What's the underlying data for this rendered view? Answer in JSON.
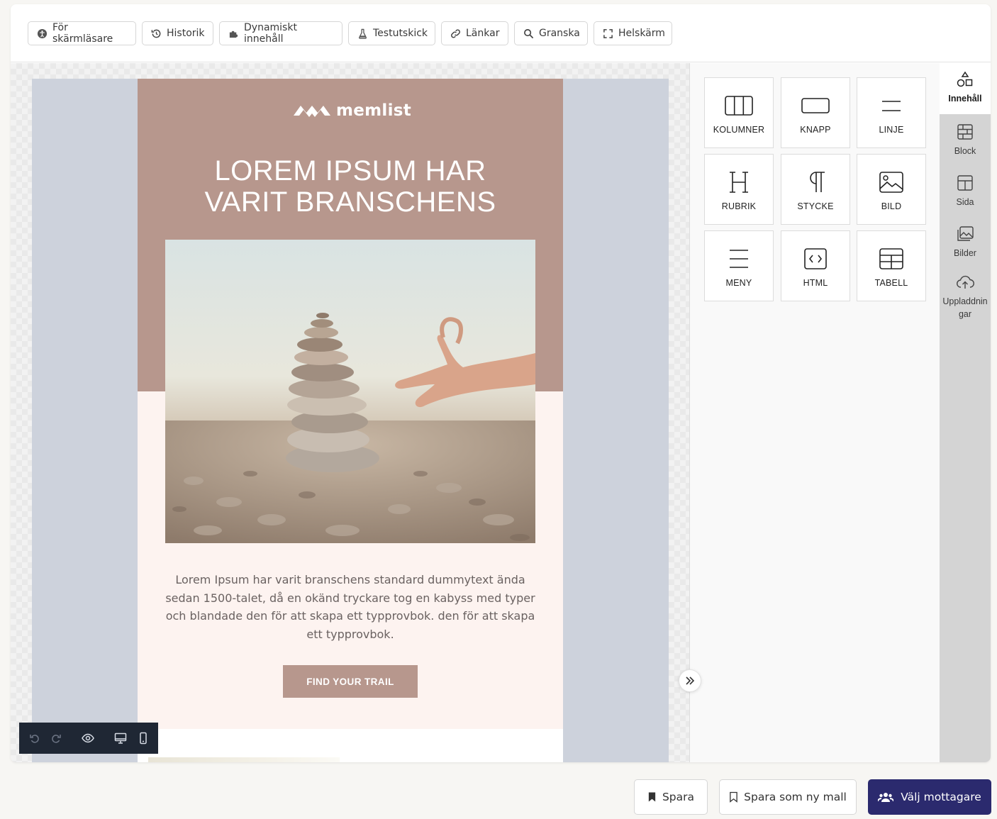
{
  "toolbar": {
    "items": [
      {
        "label": "För skärmläsare",
        "icon": "accessibility-icon"
      },
      {
        "label": "Historik",
        "icon": "history-icon"
      },
      {
        "label": "Dynamiskt innehåll",
        "icon": "puzzle-icon"
      },
      {
        "label": "Testutskick",
        "icon": "flask-icon"
      },
      {
        "label": "Länkar",
        "icon": "link-icon"
      },
      {
        "label": "Granska",
        "icon": "search-icon"
      },
      {
        "label": "Helskärm",
        "icon": "fullscreen-icon"
      }
    ]
  },
  "email": {
    "logo_text": "memlist",
    "headline_line1": "LOREM IPSUM HAR",
    "headline_line2": "VARIT BRANSCHENS",
    "body_text": "Lorem Ipsum har varit branschens standard dummytext ända sedan 1500-talet, då en okänd tryckare tog en kabyss med typer och blandade den för att skapa ett typprovbok. den för att skapa ett typprovbok.",
    "cta_label": "FIND YOUR TRAIL",
    "colors": {
      "hero": "#b7978d",
      "background": "#fdf3f0",
      "outer": "#cdd2dc"
    }
  },
  "content_tiles": [
    {
      "label": "KOLUMNER",
      "icon": "columns-icon"
    },
    {
      "label": "KNAPP",
      "icon": "button-icon"
    },
    {
      "label": "LINJE",
      "icon": "divider-icon"
    },
    {
      "label": "RUBRIK",
      "icon": "heading-icon"
    },
    {
      "label": "STYCKE",
      "icon": "paragraph-icon"
    },
    {
      "label": "BILD",
      "icon": "image-icon"
    },
    {
      "label": "MENY",
      "icon": "menu-icon"
    },
    {
      "label": "HTML",
      "icon": "html-code-icon"
    },
    {
      "label": "TABELL",
      "icon": "table-icon"
    }
  ],
  "side_tabs": [
    {
      "label": "Innehåll",
      "icon": "shapes-icon",
      "active": true
    },
    {
      "label": "Block",
      "icon": "block-icon"
    },
    {
      "label": "Sida",
      "icon": "page-layout-icon"
    },
    {
      "label": "Bilder",
      "icon": "images-icon"
    },
    {
      "label": "Uppladdningar",
      "icon": "cloud-upload-icon"
    }
  ],
  "footer": {
    "save_label": "Spara",
    "save_template_label": "Spara som ny mall",
    "recipients_label": "Välj mottagare"
  },
  "colors": {
    "primary": "#2b2a6e",
    "editor_controls": "#1f2734"
  }
}
